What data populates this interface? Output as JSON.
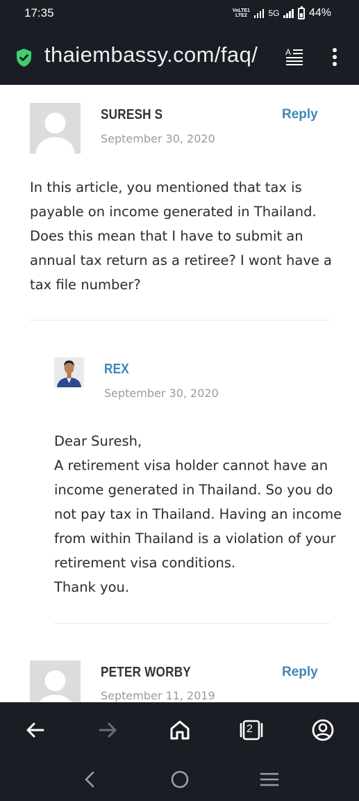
{
  "status_bar": {
    "time": "17:35",
    "volte_line1": "VoLTE1",
    "volte_line2": "LTE2",
    "network": "5G",
    "battery": "44%",
    "battery_level": 0.44
  },
  "browser": {
    "url": "thaiembassy.com/faq/",
    "tab_count": "2",
    "colors": {
      "chrome_bg": "#1b1d24",
      "secure_green": "#3fce6e"
    }
  },
  "comments": [
    {
      "author": "SURESH S",
      "date": "September 30, 2020",
      "reply_label": "Reply",
      "body_lines": [
        "In this article, you mentioned that tax is",
        "payable on income generated in Thailand.",
        "Does this mean that I have to submit an",
        "annual tax return as a retiree? I wont have a",
        "tax file number?"
      ]
    },
    {
      "author": "REX",
      "date": "September 30, 2020",
      "body_lines": [
        "Dear Suresh,",
        "A retirement visa holder cannot have an",
        "income generated in Thailand. So you do",
        "not pay tax in Thailand. Having an income",
        "from within Thailand is a violation of your",
        "retirement visa conditions.",
        "Thank you."
      ]
    },
    {
      "author": "PETER WORBY",
      "date": "September 11, 2019",
      "reply_label": "Reply"
    }
  ],
  "colors": {
    "link_blue": "#3c87b8",
    "author_dark": "#333333",
    "date_gray": "#9a9a9a"
  },
  "icons": {
    "security": "shield-check-icon",
    "reader": "reader-mode-icon",
    "menu": "more-vertical-icon",
    "back": "arrow-left-icon",
    "forward": "arrow-right-icon",
    "home": "home-icon",
    "tabs": "tab-switcher-icon",
    "account": "account-icon"
  }
}
